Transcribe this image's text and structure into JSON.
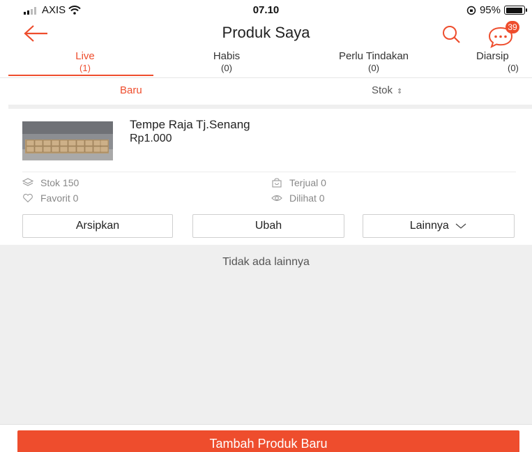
{
  "status_bar": {
    "carrier": "AXIS",
    "time": "07.10",
    "battery": "95%",
    "battery_level": 0.95
  },
  "header": {
    "title": "Produk Saya",
    "chat_badge": "39",
    "back_icon": "arrow-left-icon",
    "search_icon": "search-icon",
    "chat_icon": "chat-bubble-icon"
  },
  "tabs": [
    {
      "label": "Live",
      "count": "(1)",
      "active": true
    },
    {
      "label": "Habis",
      "count": "(0)",
      "active": false
    },
    {
      "label": "Perlu Tindakan",
      "count": "(0)",
      "active": false
    },
    {
      "label": "Diarsip",
      "count": "(0)",
      "active": false
    }
  ],
  "sort": {
    "newest": "Baru",
    "stock": "Stok",
    "stock_icon": "sort-arrows-icon"
  },
  "product": {
    "name": "Tempe Raja Tj.Senang",
    "price": "Rp1.000",
    "stats": {
      "stock": "Stok 150",
      "sold": "Terjual 0",
      "favorite": "Favorit 0",
      "views": "Dilihat 0"
    },
    "actions": {
      "archive": "Arsipkan",
      "edit": "Ubah",
      "more": "Lainnya"
    }
  },
  "empty_message": "Tidak ada lainnya",
  "add_button": "Tambah Produk Baru",
  "colors": {
    "accent": "#ee4d2d",
    "background_gray": "#efefef",
    "text_muted": "#888888"
  }
}
